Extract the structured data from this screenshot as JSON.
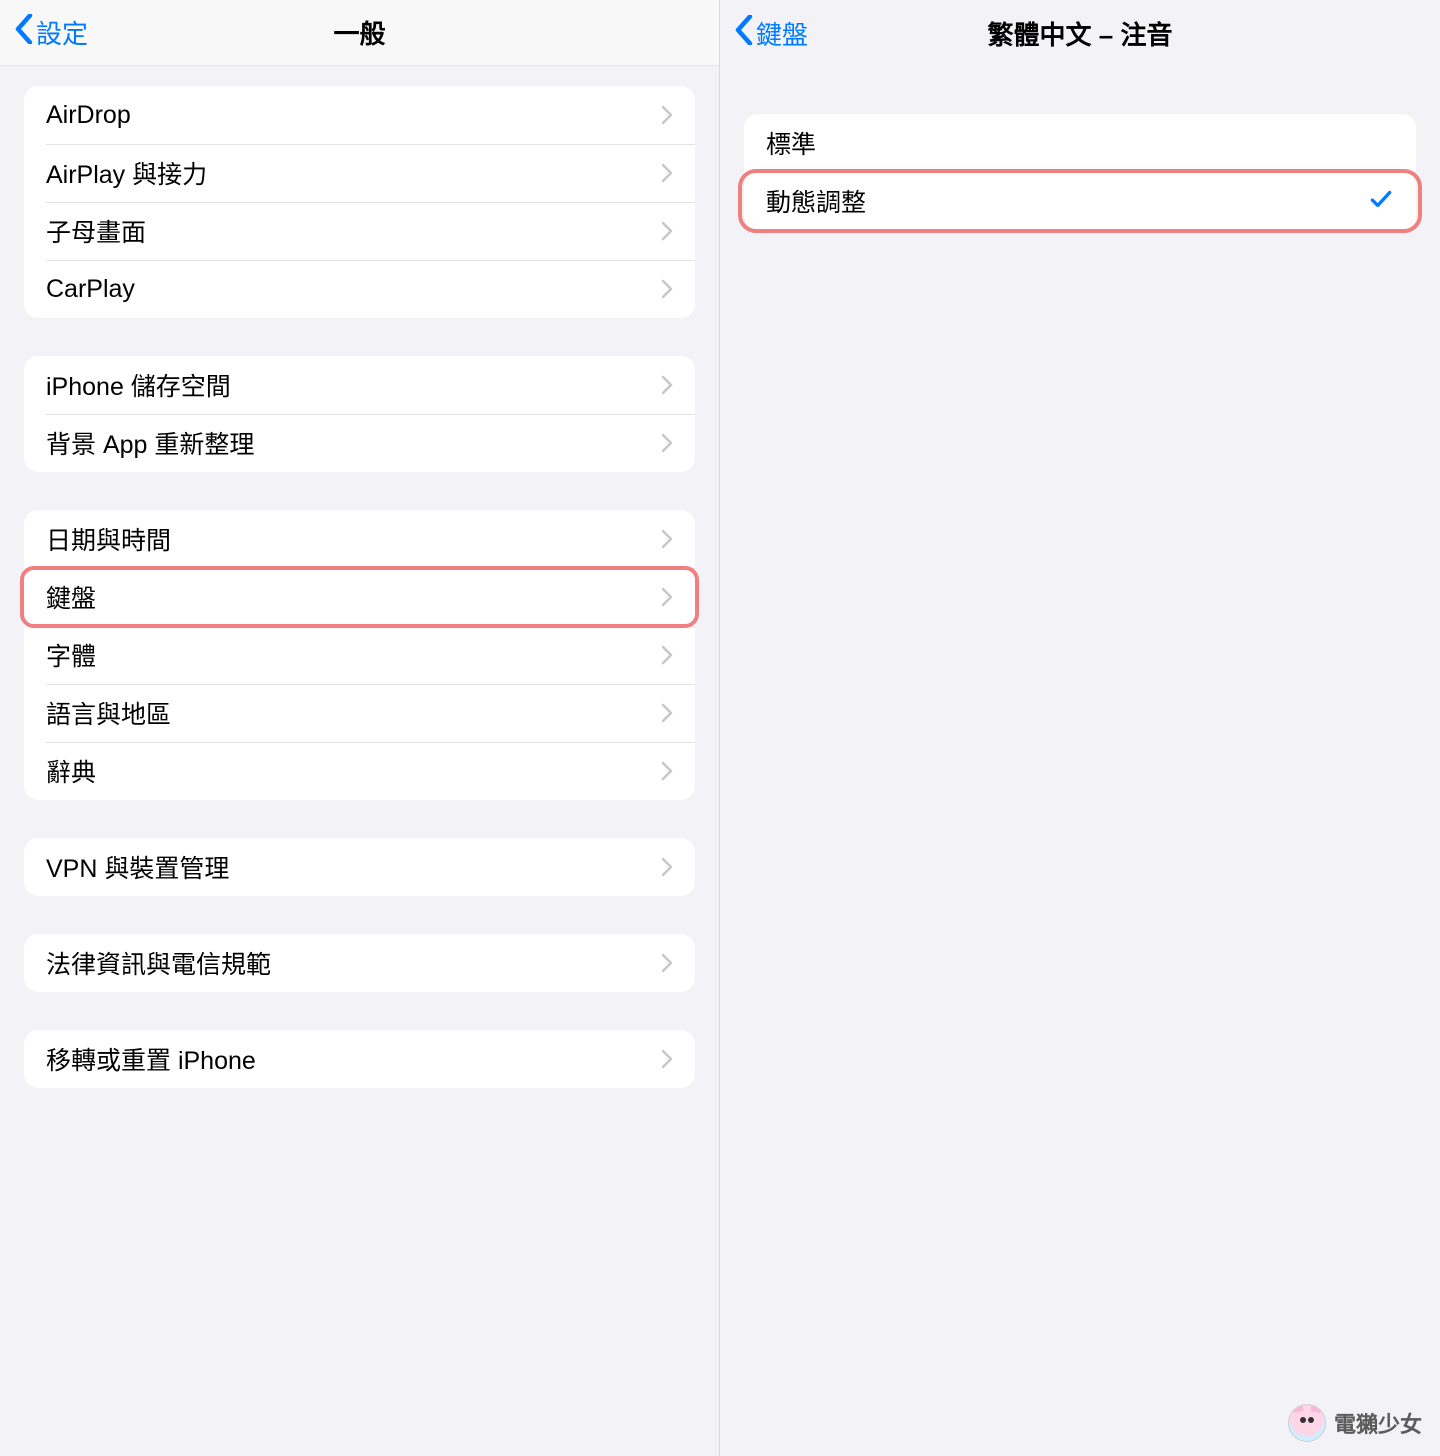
{
  "colors": {
    "accent": "#007aff",
    "highlight": "#f08080"
  },
  "left": {
    "back_label": "設定",
    "title": "一般",
    "groups": [
      {
        "rows": [
          {
            "label": "AirDrop"
          },
          {
            "label": "AirPlay 與接力"
          },
          {
            "label": "子母畫面"
          },
          {
            "label": "CarPlay"
          }
        ]
      },
      {
        "rows": [
          {
            "label": "iPhone 儲存空間"
          },
          {
            "label": "背景 App 重新整理"
          }
        ]
      },
      {
        "rows": [
          {
            "label": "日期與時間"
          },
          {
            "label": "鍵盤",
            "highlight": true
          },
          {
            "label": "字體"
          },
          {
            "label": "語言與地區"
          },
          {
            "label": "辭典"
          }
        ]
      },
      {
        "rows": [
          {
            "label": "VPN 與裝置管理"
          }
        ]
      },
      {
        "rows": [
          {
            "label": "法律資訊與電信規範"
          }
        ]
      },
      {
        "rows": [
          {
            "label": "移轉或重置 iPhone"
          }
        ]
      }
    ]
  },
  "right": {
    "back_label": "鍵盤",
    "title": "繁體中文 – 注音",
    "rows": [
      {
        "label": "標準",
        "checked": false
      },
      {
        "label": "動態調整",
        "checked": true,
        "highlight": true
      }
    ]
  },
  "watermark": "電獺少女"
}
